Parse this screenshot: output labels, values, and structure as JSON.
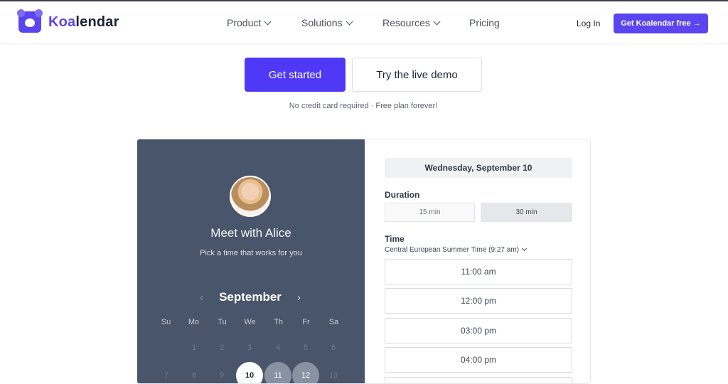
{
  "brand": {
    "prefix": "Koa",
    "suffix": "lendar"
  },
  "nav": {
    "product": "Product",
    "solutions": "Solutions",
    "resources": "Resources",
    "pricing": "Pricing",
    "login": "Log In",
    "cta": "Get Koalendar free →"
  },
  "hero": {
    "primary": "Get started",
    "secondary": "Try the live demo",
    "note": "No credit card required  ·  Free plan forever!"
  },
  "widget": {
    "title": "Meet with Alice",
    "subtitle": "Pick a time that works for you",
    "month": "September",
    "prev": "‹",
    "next": "›",
    "weekdays": [
      "Su",
      "Mo",
      "Tu",
      "We",
      "Th",
      "Fr",
      "Sa"
    ],
    "row1": [
      "1",
      "2",
      "3",
      "4",
      "5",
      "6"
    ],
    "row2": [
      "7",
      "8",
      "9",
      "10",
      "11",
      "12",
      "13"
    ],
    "selected_date": "Wednesday, September 10",
    "duration_label": "Duration",
    "durations": [
      "15 min",
      "30 min"
    ],
    "time_label": "Time",
    "timezone": "Central European Summer Time (9:27 am)",
    "slots": [
      "11:00 am",
      "12:00 pm",
      "03:00 pm",
      "04:00 pm"
    ]
  },
  "colors": {
    "brand": "#5b45f0",
    "panel": "#49556a"
  }
}
